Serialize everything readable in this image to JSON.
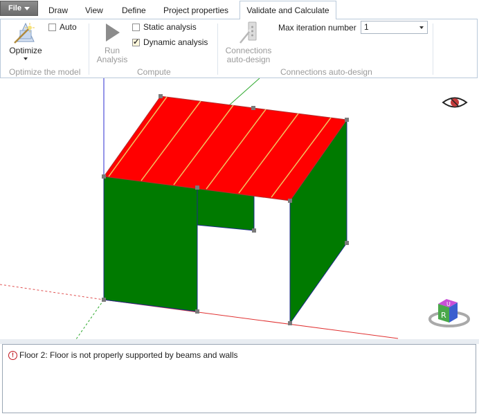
{
  "menu": {
    "file_label": "File",
    "tabs": [
      "Draw",
      "View",
      "Define",
      "Project properties",
      "Validate and Calculate"
    ],
    "active_tab": "Validate and Calculate"
  },
  "ribbon": {
    "optimize_group": {
      "optimize_label": "Optimize",
      "auto_label": "Auto",
      "auto_checked": false,
      "group_label": "Optimize the model"
    },
    "compute_group": {
      "run_label_1": "Run",
      "run_label_2": "Analysis",
      "static_label": "Static analysis",
      "static_checked": false,
      "dynamic_label": "Dynamic analysis",
      "dynamic_checked": true,
      "group_label": "Compute"
    },
    "connections_group": {
      "connections_label_1": "Connections",
      "connections_label_2": "auto-design",
      "max_iter_label": "Max iteration number",
      "max_iter_value": "1",
      "group_label": "Connections auto-design"
    }
  },
  "viewport": {
    "nav_cube_top_face": "U",
    "nav_cube_front_face": "R"
  },
  "messages": [
    {
      "text": "Floor 2: Floor is not properly supported by beams and walls",
      "severity": "error"
    }
  ],
  "colors": {
    "roof": "#ff0000",
    "walls": "#007a00",
    "accent": "#b9c9da",
    "error": "#c0141c"
  }
}
